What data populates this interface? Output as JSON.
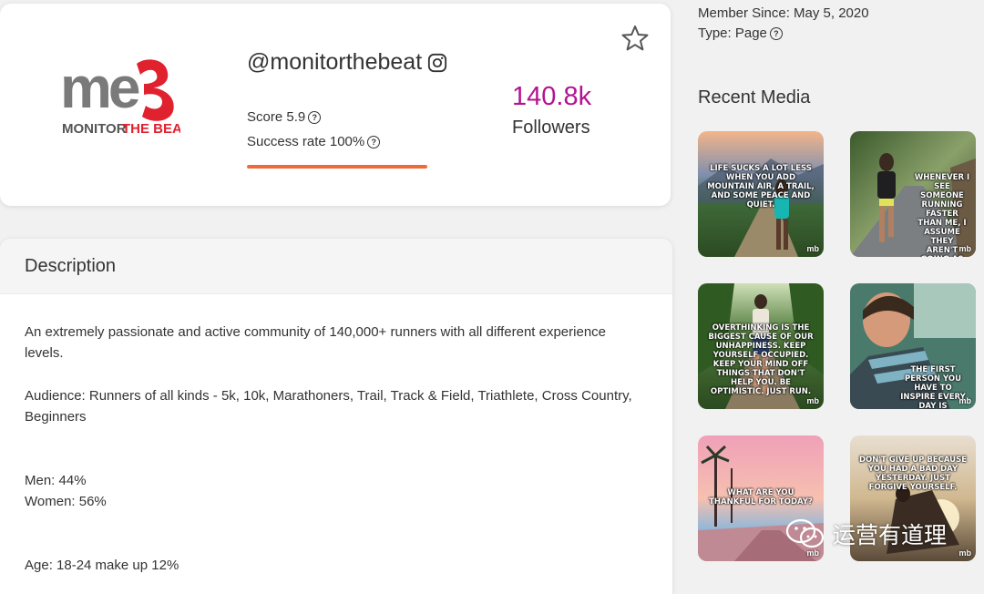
{
  "profile": {
    "logo_text": "MONITOR THE BEAT",
    "handle": "@monitorthebeat",
    "score_label": "Score 5.9",
    "success_label": "Success rate 100%",
    "success_rate": 1.0,
    "followers_count": "140.8k",
    "followers_label": "Followers",
    "colors": {
      "followers": "#b3138f",
      "progress": "#ef6a3a"
    }
  },
  "meta": {
    "member_since": "Member Since: May 5, 2020",
    "type": "Type: Page"
  },
  "description": {
    "title": "Description",
    "intro": "An extremely passionate and active community of 140,000+ runners with all different experience levels.",
    "audience": "Audience: Runners of all kinds - 5k, 10k, Marathoners, Trail, Track & Field, Triathlete, Cross Country, Beginners",
    "men": "Men: 44%",
    "women": "Women: 56%",
    "age": "Age: 18-24 make up 12%"
  },
  "recent_media": {
    "title": "Recent Media",
    "items": [
      {
        "caption": "Life sucks a lot less when you add mountain air, a trail, and some peace and quiet.",
        "brand": "mb"
      },
      {
        "caption": "Whenever I see someone running faster than me, I assume they aren't going as far.",
        "brand": "mb"
      },
      {
        "caption": "Overthinking is the biggest cause of our unhappiness. Keep yourself occupied. Keep your mind off things that don't help you. Be optimistic. Just run.",
        "brand": "mb"
      },
      {
        "caption": "The first person you have to inspire every day is yourself. Running will do that.",
        "brand": "mb"
      },
      {
        "caption": "What are you thankful for today?",
        "brand": "mb"
      },
      {
        "caption": "Don't give up because you had a bad day yesterday. Just forgive yourself.",
        "brand": "mb"
      }
    ]
  },
  "watermark": {
    "text": "运营有道理"
  }
}
